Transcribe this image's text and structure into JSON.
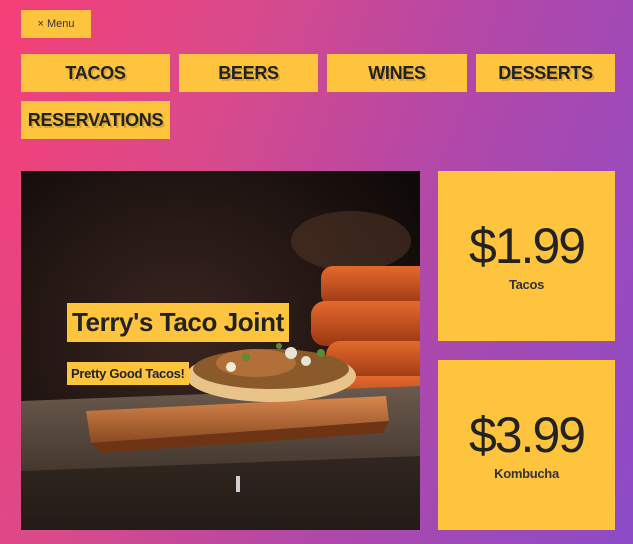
{
  "menu_button": {
    "icon": "close-icon",
    "glyph": "×",
    "label": "Menu"
  },
  "nav": {
    "items": [
      {
        "label": "TACOS"
      },
      {
        "label": "BEERS"
      },
      {
        "label": "WINES"
      },
      {
        "label": "DESSERTS"
      },
      {
        "label": "RESERVATIONS"
      }
    ]
  },
  "hero": {
    "title": "Terry's Taco Joint",
    "subtitle": "Pretty Good Tacos!"
  },
  "prices": [
    {
      "value": "$1.99",
      "label": "Tacos"
    },
    {
      "value": "$3.99",
      "label": "Kombucha"
    }
  ],
  "colors": {
    "accent": "#ffc43d",
    "gradient_start": "#f63f77",
    "gradient_end": "#8c4bc8"
  }
}
